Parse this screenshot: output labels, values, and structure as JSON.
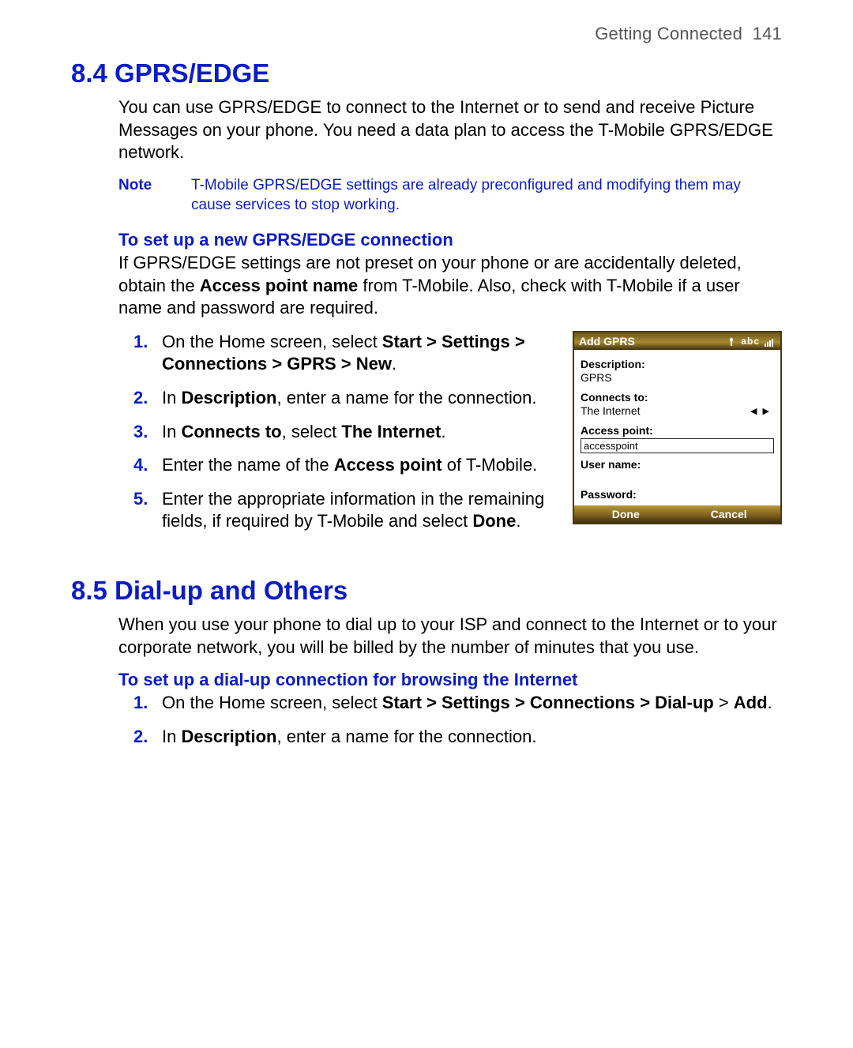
{
  "header": {
    "chapter": "Getting Connected",
    "pagenum": "141"
  },
  "s84": {
    "heading": "8.4  GPRS/EDGE",
    "intro": "You can use GPRS/EDGE to connect to the Internet or to send and receive Picture Messages on your phone. You need a data plan to access the T-Mobile GPRS/EDGE network.",
    "note_label": "Note",
    "note_text": "T-Mobile GPRS/EDGE settings are already preconfigured and modifying them may cause services to stop working.",
    "subhead": "To set up a new GPRS/EDGE connection",
    "para2_a": "If GPRS/EDGE settings are not preset on your phone or are accidentally deleted, obtain the ",
    "para2_bold": "Access point name",
    "para2_b": " from T-Mobile. Also, check with T-Mobile if a user name and password are required.",
    "steps": {
      "s1_a": "On the Home screen, select ",
      "s1_bold": "Start > Settings > Connections > GPRS > New",
      "s1_b": ".",
      "s2_a": "In ",
      "s2_bold": "Description",
      "s2_b": ", enter a name for the connection.",
      "s3_a": "In ",
      "s3_bold1": "Connects to",
      "s3_mid": ", select ",
      "s3_bold2": "The Internet",
      "s3_b": ".",
      "s4_a": "Enter the name of the ",
      "s4_bold": "Access point",
      "s4_b": " of T-Mobile.",
      "s5_a": "Enter the appropriate information in the remaining fields, if required by T-Mobile and select ",
      "s5_bold": "Done",
      "s5_b": "."
    }
  },
  "phone": {
    "title": "Add GPRS",
    "status_text": "abc",
    "lbl_desc": "Description:",
    "val_desc": "GPRS",
    "lbl_conn": "Connects to:",
    "val_conn": "The Internet",
    "lbl_ap": "Access point:",
    "val_ap": "accesspoint",
    "lbl_user": "User name:",
    "lbl_pass": "Password:",
    "soft_left": "Done",
    "soft_right": "Cancel"
  },
  "s85": {
    "heading": "8.5  Dial-up and Others",
    "intro": "When you use your phone to dial up to your ISP and connect to the Internet or to your corporate network, you will be billed by the number of minutes that you use.",
    "subhead": "To set up a dial-up connection for browsing the Internet",
    "steps": {
      "s1_a": "On the Home screen, select ",
      "s1_bold": "Start > Settings > Connections > Dial-up",
      "s1_mid": " > ",
      "s1_bold2": "Add",
      "s1_b": ".",
      "s2_a": "In ",
      "s2_bold": "Description",
      "s2_b": ", enter a name for the connection."
    }
  }
}
